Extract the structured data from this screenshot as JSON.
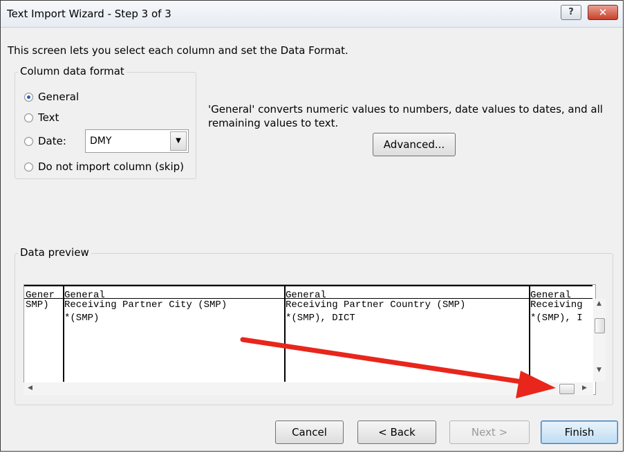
{
  "window": {
    "title": "Text Import Wizard - Step 3 of 3",
    "help_label": "?",
    "close_label": "✕"
  },
  "intro": "This screen lets you select each column and set the Data Format.",
  "column_format": {
    "legend": "Column data format",
    "options": [
      {
        "label": "General",
        "checked": true
      },
      {
        "label": "Text",
        "checked": false
      },
      {
        "label": "Date:",
        "checked": false
      },
      {
        "label": "Do not import column (skip)",
        "checked": false
      }
    ],
    "date_format": "DMY"
  },
  "description": "'General' converts numeric values to numbers, date values to dates, and all remaining values to text.",
  "advanced_label": "Advanced...",
  "preview": {
    "legend": "Data preview",
    "columns": [
      {
        "header": "Gener",
        "rows": [
          "SMP)",
          ""
        ]
      },
      {
        "header": "General",
        "rows": [
          "Receiving Partner City (SMP)",
          "*(SMP)"
        ]
      },
      {
        "header": "General",
        "rows": [
          "Receiving Partner Country (SMP)",
          "*(SMP), DICT"
        ]
      },
      {
        "header": "General",
        "rows": [
          "Receiving",
          "*(SMP), I"
        ]
      }
    ]
  },
  "buttons": {
    "cancel": "Cancel",
    "back": "< Back",
    "next": "Next >",
    "finish": "Finish"
  },
  "colors": {
    "annotation_arrow": "#e8261c",
    "accent": "#2a5fa8"
  }
}
